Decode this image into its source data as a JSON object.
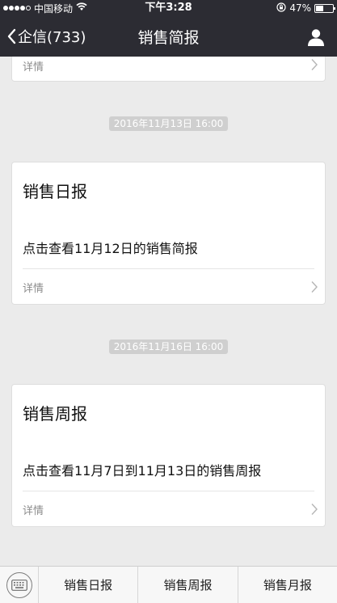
{
  "status_bar": {
    "carrier": "中国移动",
    "time": "下午3:28",
    "battery": "47%",
    "battery_level": 0.47
  },
  "nav": {
    "back_label": "企信(733)",
    "title": "销售简报"
  },
  "messages": [
    {
      "detail_label": "详情"
    },
    {
      "timestamp": "2016年11月13日 16:00",
      "title": "销售日报",
      "description": "点击查看11月12日的销售简报",
      "detail_label": "详情"
    },
    {
      "timestamp": "2016年11月16日 16:00",
      "title": "销售周报",
      "description": "点击查看11月7日到11月13日的销售周报",
      "detail_label": "详情"
    }
  ],
  "bottom_menu": {
    "items": [
      {
        "label": "销售日报"
      },
      {
        "label": "销售周报"
      },
      {
        "label": "销售月报"
      }
    ],
    "keyboard_icon": "keyboard-icon"
  },
  "colors": {
    "nav_background": "#2c2c33",
    "page_background": "#ebebeb",
    "timestamp_background": "#cfcfcf",
    "detail_text": "#8c8c8c"
  }
}
